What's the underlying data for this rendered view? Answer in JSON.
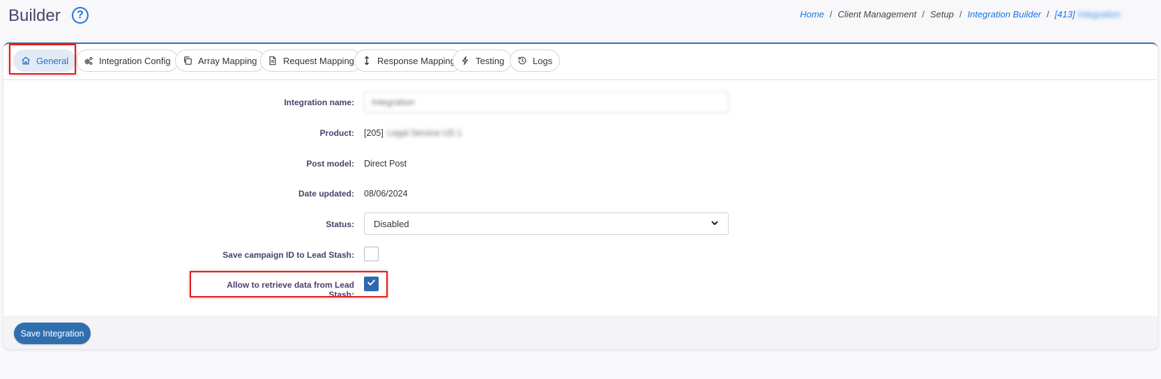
{
  "header": {
    "title": "Builder",
    "help_icon": "?"
  },
  "breadcrumb": {
    "items": [
      {
        "label": "Home",
        "link": true
      },
      {
        "label": "Client Management",
        "link": false
      },
      {
        "label": "Setup",
        "link": false
      },
      {
        "label": "Integration Builder",
        "link": true
      },
      {
        "label": "[413]",
        "link": true
      }
    ],
    "separator": "/",
    "blurred_suffix": "Integration"
  },
  "tabs": [
    {
      "label": "General",
      "icon": "home-icon",
      "active": true
    },
    {
      "label": "Integration Config",
      "icon": "gears-icon",
      "active": false
    },
    {
      "label": "Array Mapping",
      "icon": "copy-icon",
      "active": false
    },
    {
      "label": "Request Mapping",
      "icon": "document-icon",
      "active": false
    },
    {
      "label": "Response Mapping",
      "icon": "arrows-vertical-icon",
      "active": false
    },
    {
      "label": "Testing",
      "icon": "bolt-icon",
      "active": false
    },
    {
      "label": "Logs",
      "icon": "history-icon",
      "active": false
    }
  ],
  "form": {
    "integration_name": {
      "label": "Integration name:",
      "value": "Integration"
    },
    "product": {
      "label": "Product:",
      "prefix": "[205]",
      "blurred_value": "Legal Service US 1"
    },
    "post_model": {
      "label": "Post model:",
      "value": "Direct Post"
    },
    "date_updated": {
      "label": "Date updated:",
      "value": "08/06/2024"
    },
    "status": {
      "label": "Status:",
      "value": "Disabled"
    },
    "save_campaign_id": {
      "label": "Save campaign ID to Lead Stash:",
      "checked": false
    },
    "allow_retrieve": {
      "label": "Allow to retrieve data from Lead Stash:",
      "checked": true
    }
  },
  "footer": {
    "save_label": "Save Integration"
  },
  "colors": {
    "accent": "#2f6fb0",
    "link": "#1a73e8",
    "highlight": "#e01b1b"
  }
}
